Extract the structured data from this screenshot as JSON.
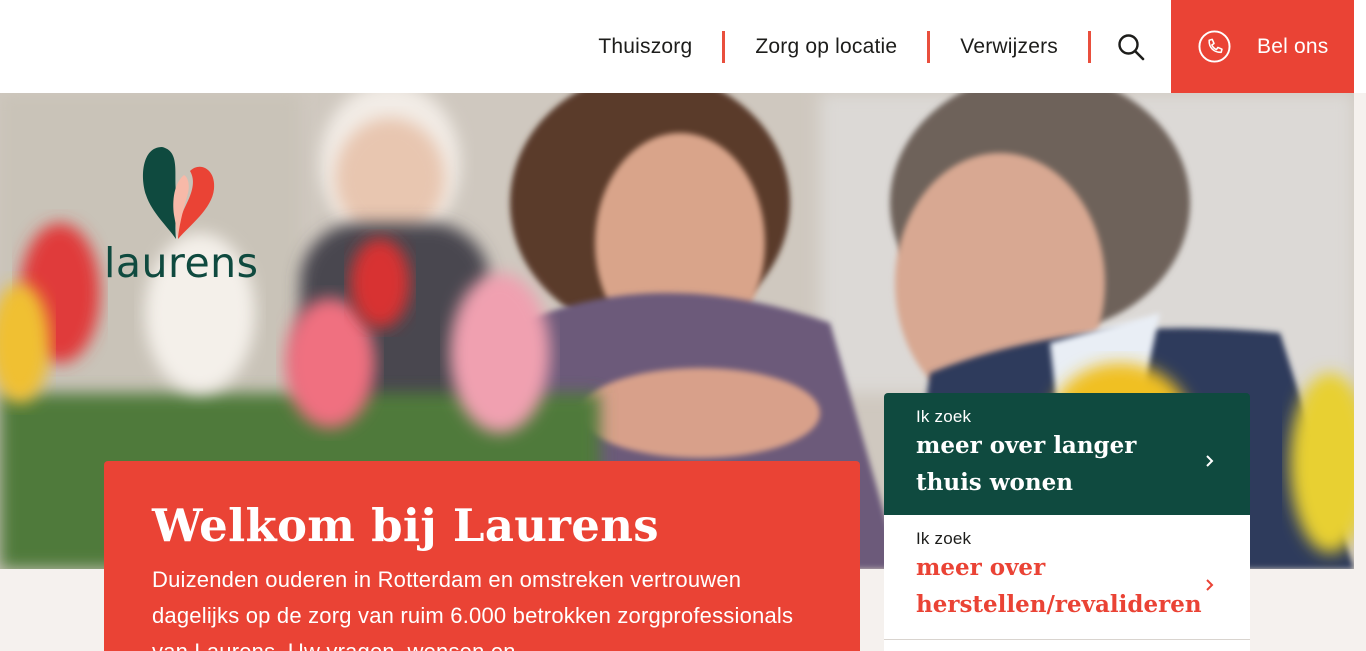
{
  "header": {
    "nav": [
      "Thuiszorg",
      "Zorg op locatie",
      "Verwijzers"
    ],
    "search_icon": "search-icon",
    "call_label": "Bel ons",
    "call_icon": "phone-icon",
    "accent_color": "#ea4335"
  },
  "brand": {
    "name": "laurens",
    "primary_color": "#0f4a3f"
  },
  "welcome": {
    "title": "Welkom bij Laurens",
    "body": "Duizenden ouderen in Rotterdam en omstreken vertrouwen dagelijks op de zorg van ruim 6.000 betrokken zorgprofessionals van Laurens. Uw vragen, wensen en"
  },
  "search_cards": [
    {
      "prefix": "Ik zoek",
      "label": "meer over langer thuis wonen"
    },
    {
      "prefix": "Ik zoek",
      "label": "meer over herstellen/revalideren"
    }
  ]
}
